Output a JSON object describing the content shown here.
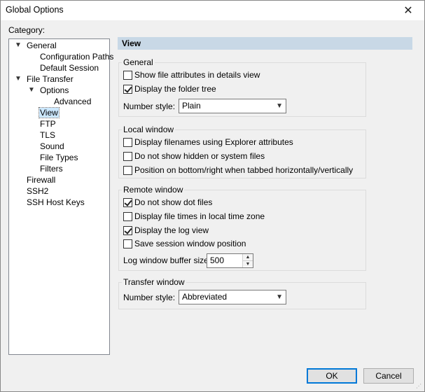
{
  "window": {
    "title": "Global Options",
    "close_glyph": "✕"
  },
  "sidebar": {
    "category_label": "Category:",
    "tree": [
      {
        "label": "General",
        "expanded": true
      },
      {
        "label": "Configuration Paths"
      },
      {
        "label": "Default Session"
      },
      {
        "label": "File Transfer",
        "expanded": true
      },
      {
        "label": "Options",
        "expanded": true
      },
      {
        "label": "Advanced"
      },
      {
        "label": "View",
        "selected": true
      },
      {
        "label": "FTP"
      },
      {
        "label": "TLS"
      },
      {
        "label": "Sound"
      },
      {
        "label": "File Types"
      },
      {
        "label": "Filters"
      },
      {
        "label": "Firewall"
      },
      {
        "label": "SSH2"
      },
      {
        "label": "SSH Host Keys"
      }
    ]
  },
  "panel": {
    "header": "View",
    "general": {
      "title": "General",
      "show_file_attributes": {
        "label": "Show file attributes in details view",
        "checked": false
      },
      "display_folder_tree": {
        "label": "Display the folder tree",
        "checked": true
      },
      "number_style_label": "Number style:",
      "number_style_value": "Plain"
    },
    "local_window": {
      "title": "Local window",
      "display_filenames": {
        "label": "Display filenames using Explorer attributes",
        "checked": false
      },
      "hidden_files": {
        "label": "Do not show hidden or system files",
        "checked": false
      },
      "position_bottom_right": {
        "label": "Position on bottom/right when tabbed horizontally/vertically",
        "checked": false
      }
    },
    "remote_window": {
      "title": "Remote window",
      "dot_files": {
        "label": "Do not show dot files",
        "checked": true
      },
      "local_time_zone": {
        "label": "Display file times in local time zone",
        "checked": false
      },
      "log_view": {
        "label": "Display the log view",
        "checked": true
      },
      "save_session_window": {
        "label": "Save session window position",
        "checked": false
      },
      "log_buffer_label": "Log window buffer size:",
      "log_buffer_value": "500"
    },
    "transfer_window": {
      "title": "Transfer window",
      "number_style_label": "Number style:",
      "number_style_value": "Abbreviated"
    }
  },
  "buttons": {
    "ok": "OK",
    "cancel": "Cancel"
  },
  "icons": {
    "expanded": "chevron-down-icon",
    "dropdown": "dropdown-arrow-icon",
    "spin_up": "spin-up-icon",
    "spin_down": "spin-down-icon"
  },
  "colors": {
    "header_bg": "#c8d8e6",
    "selection_bg": "#cce8ff",
    "default_button_border": "#0078d7"
  }
}
